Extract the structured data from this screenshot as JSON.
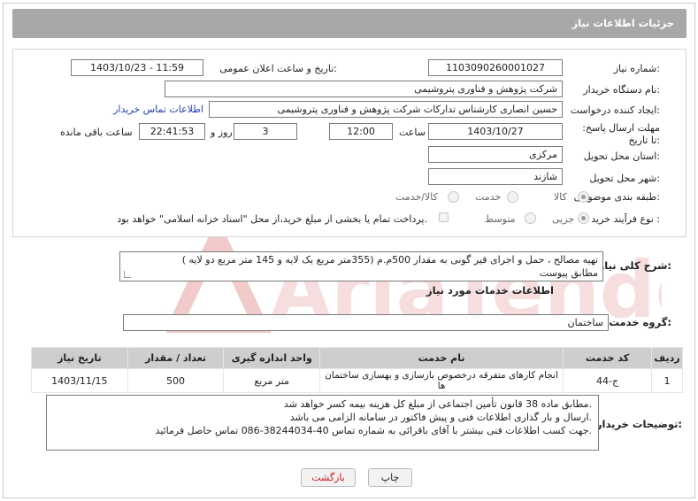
{
  "header": {
    "title": "جزئیات اطلاعات نیاز"
  },
  "form": {
    "need_number_label": "شماره نیاز:",
    "need_number": "1103090260001027",
    "announce_label": "تاریخ و ساعت اعلان عمومی:",
    "announce_value": "1403/10/23 - 11:59",
    "buyer_org_label": "نام دستگاه خریدار:",
    "buyer_org": "شرکت پژوهش و فناوری پتروشیمی",
    "creator_label": "ایجاد کننده درخواست:",
    "creator": "حسین انصاری کارشناس تدارکات شرکت پژوهش و فناوری پتروشیمی",
    "contact_link": "اطلاعات تماس خریدار",
    "deadline_label": "مهلت ارسال پاسخ: تا تاریخ:",
    "deadline_date": "1403/10/27",
    "time_label": "ساعت",
    "deadline_time": "12:00",
    "days": "3",
    "days_label": "روز و",
    "remaining": "22:41:53",
    "remaining_label": "ساعت باقی مانده",
    "province_label": "استان محل تحویل:",
    "province": "مرکزی",
    "city_label": "شهر محل تحویل:",
    "city": "شازند",
    "category_label": "طبقه بندی موضوعی:",
    "category_options": [
      "کالا",
      "خدمت",
      "کالا/خدمت"
    ],
    "purchase_type_label": "نوع فرآیند خرید :",
    "purchase_options": [
      "جزیی",
      "متوسط"
    ],
    "payment_note": "پرداخت تمام یا بخشی از مبلغ خرید،از محل \"اسناد خزانه اسلامی\" خواهد بود."
  },
  "summary": {
    "label": "شرح کلی نیاز:",
    "line1": "تهیه مصالح ، حمل و اجرای قیر گونی به مقدار 500م.م (355متر مربع یک لایه و 145 متر مربع دو لایه )",
    "line2": "مطابق پیوست"
  },
  "services": {
    "section_title": "اطلاعات خدمات مورد نیاز",
    "group_label": "گروه خدمت:",
    "group": "ساختمان",
    "columns": [
      "ردیف",
      "کد خدمت",
      "نام خدمت",
      "واحد اندازه گیری",
      "تعداد / مقدار",
      "تاریخ نیاز"
    ],
    "rows": [
      [
        "1",
        "ج-44",
        "انجام کارهای متفرقه درخصوص بازسازی و بهسازی ساختمان ها",
        "متر مربع",
        "500",
        "1403/11/15"
      ]
    ]
  },
  "notes": {
    "label": "توضیحات خریدار:",
    "line1": "مطابق ماده 38 قانون تأمین اجتماعی از مبلغ کل هزینه بیمه کسر خواهد شد.",
    "line2": "ارسال و بار گذاری اطلاعات فنی و پیش فاکتور در سامانه الزامی می باشد.",
    "line3": "جهت کسب اطلاعات فنی بیشتر با آقای باقرائی به شماره تماس  40-38244034-086 تماس حاصل فرمائید."
  },
  "buttons": {
    "print": "چاپ",
    "back": "بازگشت"
  },
  "watermark": {
    "text": "AriaTender.net"
  },
  "colors": {
    "header_bg": "#a8a8a8",
    "table_header": "#cecece",
    "link": "#1f3fb8",
    "back_text": "#d11a1a",
    "watermark": "#f3d3d3"
  }
}
